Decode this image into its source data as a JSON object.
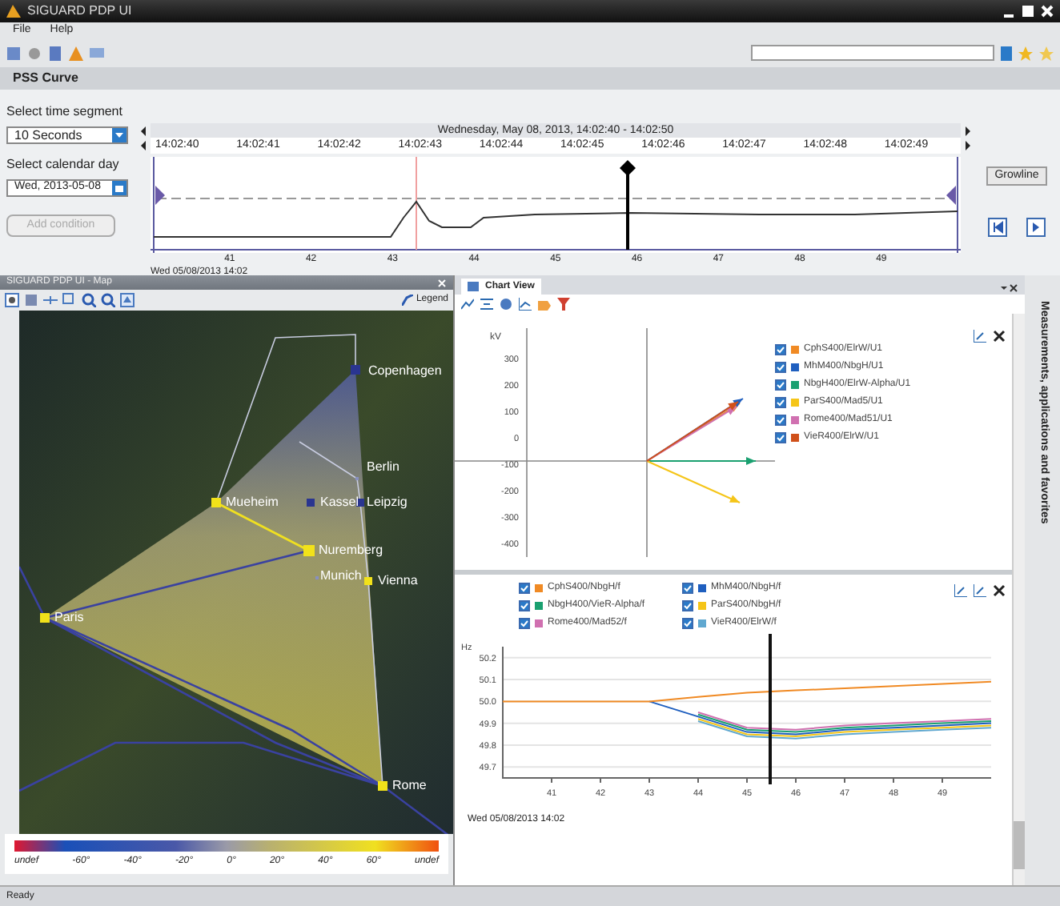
{
  "window": {
    "title": "SIGUARD PDP UI"
  },
  "menu": [
    "File",
    "Help"
  ],
  "section_title": "PSS Curve",
  "timeline": {
    "segment_label": "Select time segment",
    "segment_value": "10 Seconds",
    "day_label": "Select calendar day",
    "day_value": "Wed, 2013-05-08",
    "add_button": {
      "label": "Add condition",
      "disabled": true
    },
    "range": "Wednesday, May 08, 2013, 14:02:40 - 14:02:50",
    "ticks": [
      "14:02:40",
      "14:02:41",
      "14:02:42",
      "14:02:43",
      "14:02:44",
      "14:02:45",
      "14:02:46",
      "14:02:47",
      "14:02:48",
      "14:02:49"
    ],
    "axis_ticks": [
      "41",
      "42",
      "43",
      "44",
      "45",
      "46",
      "47",
      "48",
      "49"
    ],
    "axis_date": "Wed 05/08/2013 14:02",
    "grow_button": "Growline"
  },
  "map": {
    "title": "SIGUARD PDP UI - Map",
    "legend_button": "Legend",
    "nodes": [
      {
        "label": "Copenhagen",
        "color": "#2a3590"
      },
      {
        "label": "Berlin",
        "color": "#8890c0"
      },
      {
        "label": "Mueheim",
        "color": "#f2e21a"
      },
      {
        "label": "Kassel",
        "color": "#2a3590"
      },
      {
        "label": "Leipzig",
        "color": "#2a3590"
      },
      {
        "label": "Nuremberg",
        "color": "#f2e21a"
      },
      {
        "label": "Munich",
        "color": "#8890c0"
      },
      {
        "label": "Vienna",
        "color": "#f2e21a"
      },
      {
        "label": "Paris",
        "color": "#f2e21a"
      },
      {
        "label": "Rome",
        "color": "#f2e21a"
      }
    ],
    "scale_labels": [
      "undef",
      "-60°",
      "-40°",
      "-20°",
      "0°",
      "20°",
      "40°",
      "60°",
      "undef"
    ]
  },
  "chart_view": {
    "tab": "Chart View",
    "side_label": "Measurements, applications and favorites",
    "phasor": {
      "unit": "kV",
      "yticks": [
        "300",
        "200",
        "100",
        "0",
        "-100",
        "-200",
        "-300",
        "-400"
      ],
      "legend": [
        {
          "label": "CphS400/ElrW/U1",
          "checked": true,
          "color": "#f08a24"
        },
        {
          "label": "MhM400/NbgH/U1",
          "checked": true,
          "color": "#1f5fbf"
        },
        {
          "label": "NbgH400/ElrW-Alpha/U1",
          "checked": true,
          "color": "#1aa070"
        },
        {
          "label": "ParS400/Mad5/U1",
          "checked": true,
          "color": "#f5c518"
        },
        {
          "label": "Rome400/Mad51/U1",
          "checked": true,
          "color": "#d070b0"
        },
        {
          "label": "VieR400/ElrW/U1",
          "checked": true,
          "color": "#d0501a"
        }
      ]
    },
    "frequency": {
      "legend_checked": [
        true,
        true,
        true,
        true,
        true,
        true
      ],
      "xdate": "Wed 05/08/2013 14:02",
      "chart_data": {
        "type": "line",
        "ylabel": "Hz",
        "grid": true,
        "x": [
          40,
          41,
          42,
          43,
          44,
          45,
          46,
          47,
          48,
          49,
          50
        ],
        "xlim": [
          40,
          50
        ],
        "ylim": [
          49.65,
          50.25
        ],
        "xticks": [
          41,
          42,
          43,
          44,
          45,
          46,
          47,
          48,
          49
        ],
        "yticks": [
          {
            "value": 50.2,
            "label": "50.2"
          },
          {
            "value": 50.1,
            "label": "50.1"
          },
          {
            "value": 50.0,
            "label": "50.0"
          },
          {
            "value": 49.9,
            "label": "49.9"
          },
          {
            "value": 49.8,
            "label": "49.8"
          },
          {
            "value": 49.7,
            "label": "49.7"
          }
        ],
        "series": [
          {
            "name": "CphS400/NbgH/f",
            "color": "#f08a24",
            "values": [
              50,
              50,
              50,
              50,
              50.02,
              50.04,
              50.05,
              50.06,
              50.07,
              50.08,
              50.09
            ]
          },
          {
            "name": "MhM400/NbgH/f",
            "color": "#1f5fbf",
            "values": [
              null,
              null,
              null,
              50,
              49.93,
              49.86,
              49.85,
              49.87,
              49.88,
              49.89,
              49.9
            ]
          },
          {
            "name": "NbgH400/VieR-Alpha/f",
            "color": "#1aa070",
            "values": [
              null,
              null,
              null,
              null,
              49.94,
              49.87,
              49.86,
              49.88,
              49.89,
              49.9,
              49.91
            ]
          },
          {
            "name": "ParS400/NbgH/f",
            "color": "#f5c518",
            "values": [
              null,
              null,
              null,
              null,
              49.92,
              49.85,
              49.84,
              49.86,
              49.87,
              49.88,
              49.89
            ]
          },
          {
            "name": "Rome400/Mad52/f",
            "color": "#d070b0",
            "values": [
              null,
              null,
              null,
              null,
              49.95,
              49.88,
              49.87,
              49.89,
              49.9,
              49.91,
              49.92
            ]
          },
          {
            "name": "VieR400/ElrW/f",
            "color": "#60a8d0",
            "values": [
              null,
              null,
              null,
              null,
              49.91,
              49.84,
              49.83,
              49.85,
              49.86,
              49.87,
              49.88
            ]
          }
        ]
      }
    }
  },
  "status_bar": "Ready"
}
